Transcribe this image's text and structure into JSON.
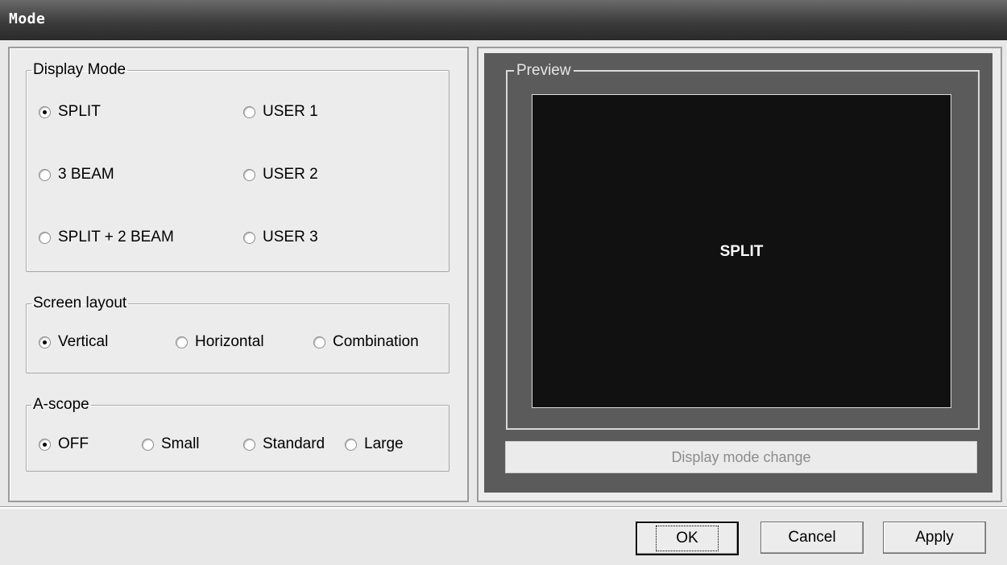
{
  "window": {
    "title": "Mode"
  },
  "display_mode": {
    "legend": "Display Mode",
    "options": [
      {
        "label": "SPLIT",
        "selected": true
      },
      {
        "label": "USER 1",
        "selected": false
      },
      {
        "label": "3 BEAM",
        "selected": false
      },
      {
        "label": "USER 2",
        "selected": false
      },
      {
        "label": "SPLIT + 2 BEAM",
        "selected": false
      },
      {
        "label": "USER 3",
        "selected": false
      }
    ]
  },
  "screen_layout": {
    "legend": "Screen layout",
    "options": [
      {
        "label": "Vertical",
        "selected": true
      },
      {
        "label": "Horizontal",
        "selected": false
      },
      {
        "label": "Combination",
        "selected": false
      }
    ]
  },
  "ascope": {
    "legend": "A-scope",
    "options": [
      {
        "label": "OFF",
        "selected": true
      },
      {
        "label": "Small",
        "selected": false
      },
      {
        "label": "Standard",
        "selected": false
      },
      {
        "label": "Large",
        "selected": false
      }
    ]
  },
  "preview": {
    "legend": "Preview",
    "screen_label": "SPLIT",
    "change_button": "Display mode change"
  },
  "buttons": {
    "ok": "OK",
    "cancel": "Cancel",
    "apply": "Apply"
  }
}
